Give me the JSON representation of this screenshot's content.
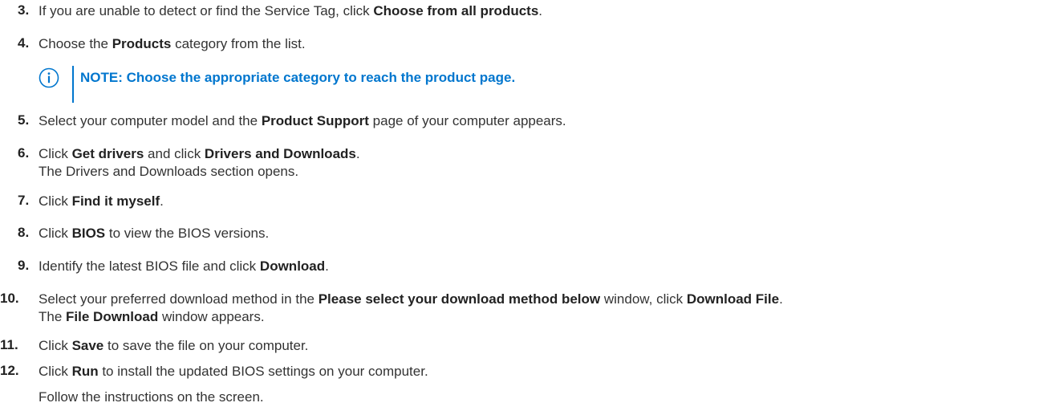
{
  "steps": [
    {
      "num": "3.",
      "parts": [
        "If you are unable to detect or find the Service Tag, click ",
        "Choose from all products",
        "."
      ]
    },
    {
      "num": "4.",
      "parts": [
        "Choose the ",
        "Products",
        " category from the list."
      ]
    },
    {
      "num": "5.",
      "parts": [
        "Select your computer model and the ",
        "Product Support",
        " page of your computer appears."
      ]
    },
    {
      "num": "6.",
      "parts": [
        "Click ",
        "Get drivers",
        " and click ",
        "Drivers and Downloads",
        "."
      ],
      "second_line": "The Drivers and Downloads section opens."
    },
    {
      "num": "7.",
      "parts": [
        "Click ",
        "Find it myself",
        "."
      ]
    },
    {
      "num": "8.",
      "parts": [
        "Click ",
        "BIOS",
        " to view the BIOS versions."
      ]
    },
    {
      "num": "9.",
      "parts": [
        "Identify the latest BIOS file and click ",
        "Download",
        "."
      ]
    },
    {
      "num": "10.",
      "parts": [
        "Select your preferred download method in the ",
        "Please select your download method below",
        " window, click ",
        "Download File",
        "."
      ],
      "second_line_parts": [
        "The ",
        "File Download",
        " window appears."
      ]
    },
    {
      "num": "11.",
      "parts": [
        "Click ",
        "Save",
        " to save the file on your computer."
      ]
    },
    {
      "num": "12.",
      "parts": [
        "Click ",
        "Run",
        " to install the updated BIOS settings on your computer."
      ]
    }
  ],
  "note": {
    "text": "NOTE: Choose the appropriate category to reach the product page.",
    "icon": "info-icon",
    "color": "#0076ce"
  },
  "follow_text": "Follow the instructions on the screen."
}
